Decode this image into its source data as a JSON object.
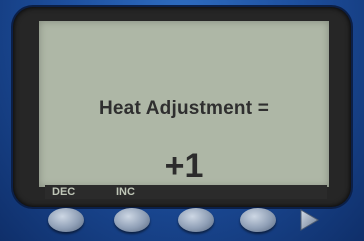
{
  "screen": {
    "title": "Heat Adjustment =",
    "value": "+1"
  },
  "softkeys": {
    "key1_label": "DEC",
    "key2_label": "INC"
  },
  "icons": {
    "next": "next-arrow-icon"
  }
}
